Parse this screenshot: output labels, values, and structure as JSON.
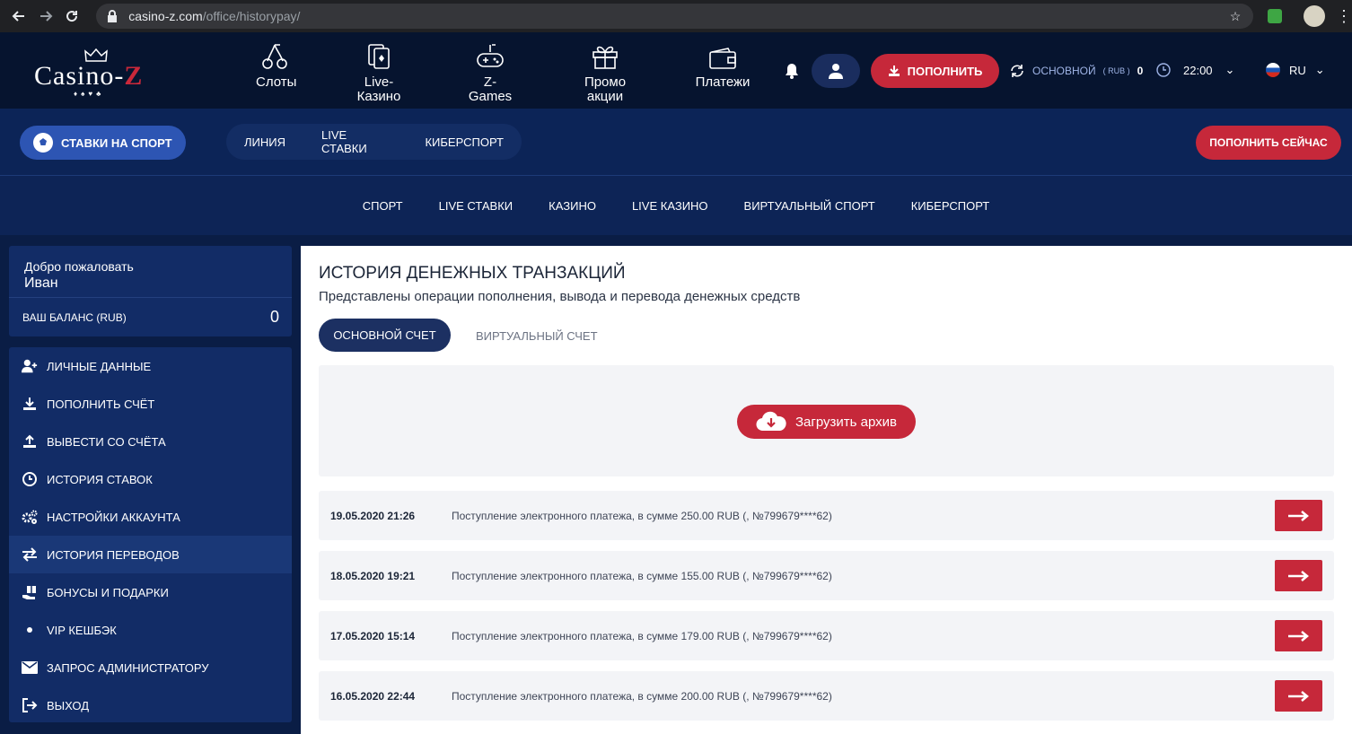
{
  "browser": {
    "url_host": "casino-z.com",
    "url_path": "/office/historypay/"
  },
  "logo": {
    "text_before": "Casino-",
    "text_z": "Z",
    "suits": "♦♠♥♣"
  },
  "main_nav": [
    {
      "label_line1": "Слоты",
      "label_line2": "",
      "icon": "cherries-icon"
    },
    {
      "label_line1": "Live-",
      "label_line2": "Казино",
      "icon": "cards-icon"
    },
    {
      "label_line1": "Z-",
      "label_line2": "Games",
      "icon": "gamepad-icon"
    },
    {
      "label_line1": "Промо",
      "label_line2": "акции",
      "icon": "gift-icon"
    },
    {
      "label_line1": "Платежи",
      "label_line2": "",
      "icon": "wallet-icon"
    }
  ],
  "header": {
    "deposit_label": "ПОПОЛНИТЬ",
    "account_label": "ОСНОВНОЙ",
    "account_currency": "( RUB )",
    "account_amount": "0",
    "time": "22:00",
    "lang": "RU"
  },
  "sport_bar": {
    "sport_button": "СТАВКИ НА СПОРТ",
    "tabs": [
      "ЛИНИЯ",
      "LIVE СТАВКИ",
      "КИБЕРСПОРТ"
    ],
    "cta": "ПОПОЛНИТЬ СЕЙЧАС"
  },
  "sub_nav": [
    "СПОРТ",
    "LIVE СТАВКИ",
    "КАЗИНО",
    "LIVE КАЗИНО",
    "ВИРТУАЛЬНЫЙ СПОРТ",
    "КИБЕРСПОРТ"
  ],
  "sidebar": {
    "welcome": "Добро пожаловать",
    "user_name": "Иван",
    "balance_label": "ВАШ БАЛАНС (RUB)",
    "balance_value": "0",
    "items": [
      {
        "label": "ЛИЧНЫЕ ДАННЫЕ",
        "icon": "user-plus-icon"
      },
      {
        "label": "ПОПОЛНИТЬ СЧЁТ",
        "icon": "download-icon"
      },
      {
        "label": "ВЫВЕСТИ СО СЧЁТА",
        "icon": "upload-icon"
      },
      {
        "label": "ИСТОРИЯ СТАВОК",
        "icon": "clock-icon"
      },
      {
        "label": "НАСТРОЙКИ АККАУНТА",
        "icon": "gears-icon"
      },
      {
        "label": "ИСТОРИЯ ПЕРЕВОДОВ",
        "icon": "exchange-icon"
      },
      {
        "label": "БОНУСЫ И ПОДАРКИ",
        "icon": "gift-hand-icon"
      },
      {
        "label": "VIP КЕШБЭК",
        "icon": "dot-icon"
      },
      {
        "label": "ЗАПРОС АДМИНИСТРАТОРУ",
        "icon": "envelope-icon"
      },
      {
        "label": "ВЫХОД",
        "icon": "logout-icon"
      }
    ]
  },
  "content": {
    "title": "ИСТОРИЯ ДЕНЕЖНЫХ ТРАНЗАКЦИЙ",
    "subtitle": "Представлены операции пополнения, вывода и перевода денежных средств",
    "tab_main": "ОСНОВНОЙ СЧЕТ",
    "tab_virtual": "ВИРТУАЛЬНЫЙ СЧЕТ",
    "archive_button": "Загрузить архив",
    "transactions": [
      {
        "date": "19.05.2020 21:26",
        "desc": "Поступление электронного платежа, в сумме 250.00 RUB (, №799679****62)"
      },
      {
        "date": "18.05.2020 19:21",
        "desc": "Поступление электронного платежа, в сумме 155.00 RUB (, №799679****62)"
      },
      {
        "date": "17.05.2020 15:14",
        "desc": "Поступление электронного платежа, в сумме 179.00 RUB (, №799679****62)"
      },
      {
        "date": "16.05.2020 22:44",
        "desc": "Поступление электронного платежа, в сумме 200.00 RUB (, №799679****62)"
      }
    ]
  },
  "colors": {
    "accent_red": "#c6283a",
    "navy": "#0a1d45",
    "sport_blue": "#2d55b3"
  }
}
